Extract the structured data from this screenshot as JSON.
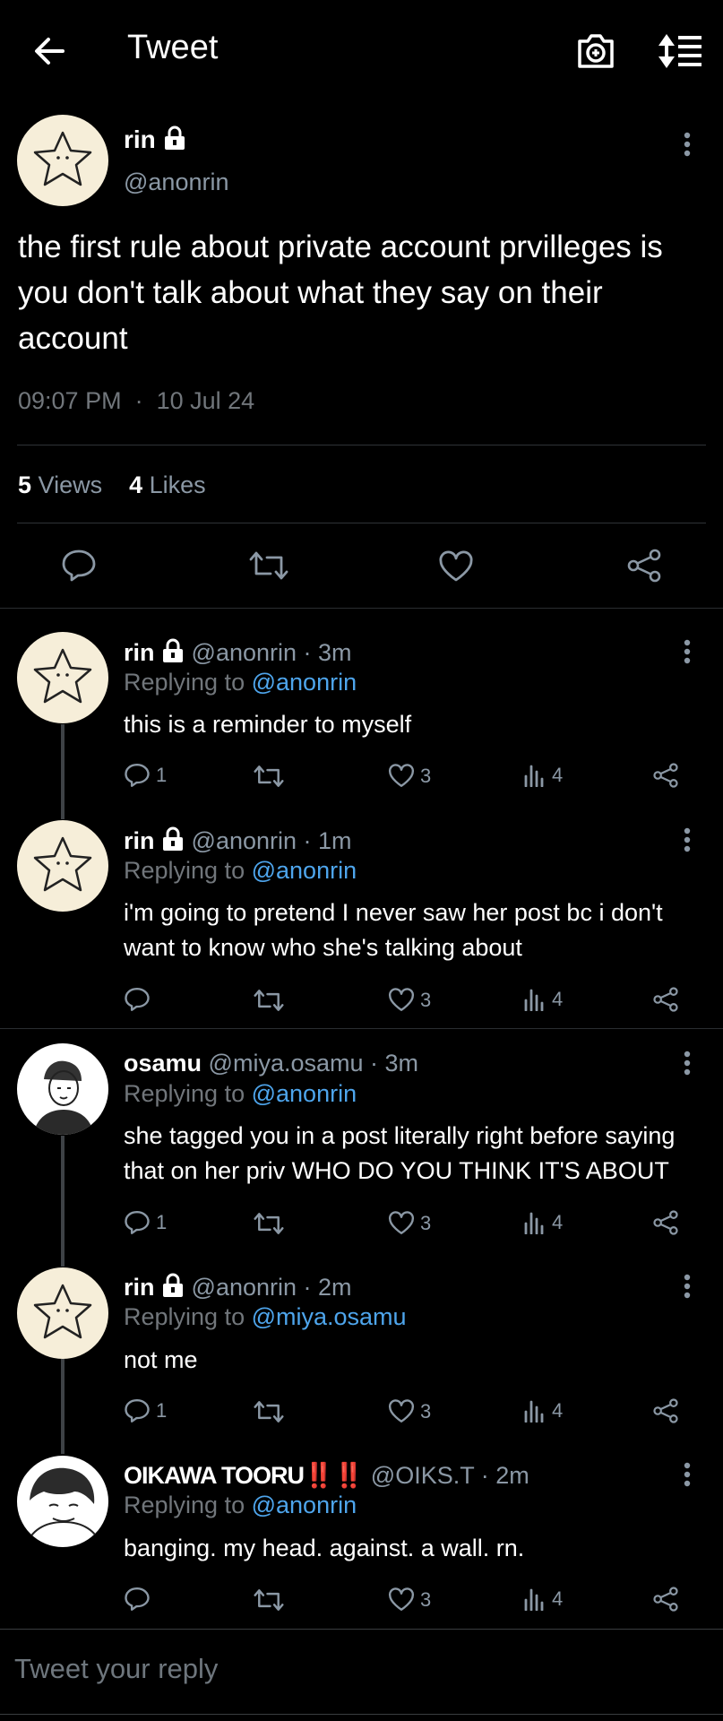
{
  "header": {
    "title": "Tweet"
  },
  "main_tweet": {
    "name": "rin",
    "handle": "@anonrin",
    "text": "the first rule about private account prvilleges is you don't talk about what they say on their account",
    "time": "09:07 PM",
    "separator": "·",
    "date": "10 Jul 24",
    "views_count": "5",
    "views_label": "Views",
    "likes_count": "4",
    "likes_label": "Likes"
  },
  "replies": [
    {
      "name": "rin",
      "handle": "@anonrin · 3m",
      "replying_label": "Replying to",
      "replying_to": "@anonrin",
      "text": "this is a reminder to myself",
      "reply_count": "1",
      "like_count": "3",
      "view_count": "4"
    },
    {
      "name": "rin",
      "handle": "@anonrin · 1m",
      "replying_label": "Replying to",
      "replying_to": "@anonrin",
      "text": "i'm going to pretend I never saw her post bc i don't want to know who she's talking about",
      "reply_count": "",
      "like_count": "3",
      "view_count": "4"
    },
    {
      "name": "osamu",
      "handle": "@miya.osamu · 3m",
      "replying_label": "Replying to",
      "replying_to": "@anonrin",
      "text": "she tagged you in a post literally right before saying that on her priv WHO DO YOU THINK IT'S ABOUT",
      "reply_count": "1",
      "like_count": "3",
      "view_count": "4"
    },
    {
      "name": "rin",
      "handle": "@anonrin · 2m",
      "replying_label": "Replying to",
      "replying_to": "@miya.osamu",
      "text": "not me",
      "reply_count": "1",
      "like_count": "3",
      "view_count": "4"
    },
    {
      "name": "OIKAWA TOORU",
      "name_emoji": "‼️‼️",
      "handle": "@OIKS.T · 2m",
      "replying_label": "Replying to",
      "replying_to": "@anonrin",
      "text": "banging. my head. against. a wall. rn.",
      "reply_count": "",
      "like_count": "3",
      "view_count": "4"
    }
  ],
  "compose": {
    "placeholder": "Tweet your reply"
  },
  "colors": {
    "background": "#000000",
    "link": "#4ea5ec",
    "muted": "#8b98a5",
    "avatar_bg": "#f6eed9"
  }
}
